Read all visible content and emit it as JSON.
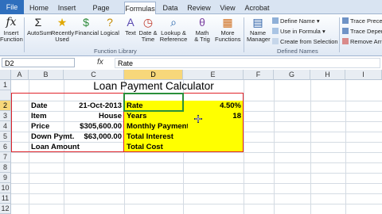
{
  "ribbon_tabs": [
    "File",
    "Home",
    "Insert",
    "Page Layout",
    "Formulas",
    "Data",
    "Review",
    "View",
    "Acrobat"
  ],
  "active_tab": "Formulas",
  "ribbon_buttons": [
    {
      "label": "Insert\nFunction",
      "icon": "fx"
    },
    {
      "label": "AutoSum",
      "icon": "Σ"
    },
    {
      "label": "Recently\nUsed",
      "icon": "★"
    },
    {
      "label": "Financial",
      "icon": "$"
    },
    {
      "label": "Logical",
      "icon": "?"
    },
    {
      "label": "Text",
      "icon": "A"
    },
    {
      "label": "Date &\nTime",
      "icon": "◷"
    },
    {
      "label": "Lookup &\nReference",
      "icon": "⌕"
    },
    {
      "label": "Math\n& Trig",
      "icon": "θ"
    },
    {
      "label": "More\nFunctions",
      "icon": "▦"
    },
    {
      "label": "Name\nManager",
      "icon": "▤"
    }
  ],
  "defined_names": [
    "Define Name",
    "Use in Formula",
    "Create from Selection"
  ],
  "auditing": [
    "Trace Preced",
    "Trace Depen",
    "Remove Arro"
  ],
  "group_labels": {
    "library": "Function Library",
    "names": "Defined Names"
  },
  "name_box": "D2",
  "fx_symbol": "fx",
  "formula": "Rate",
  "columns": [
    "A",
    "B",
    "C",
    "D",
    "E",
    "F",
    "G",
    "H",
    "I"
  ],
  "rows": [
    "1",
    "2",
    "3",
    "4",
    "5",
    "6",
    "7",
    "8",
    "9",
    "10",
    "11",
    "12"
  ],
  "title": "Loan Payment Calculator",
  "left_labels": [
    "Date",
    "Item",
    "Price",
    "Down Pymt.",
    "Loan Amount"
  ],
  "left_values": [
    "21-Oct-2013",
    "House",
    "$305,600.00",
    "$63,000.00",
    ""
  ],
  "right_labels": [
    "Rate",
    "Years",
    "Monthly Payment",
    "Total Interest",
    "Total Cost"
  ],
  "right_values": [
    "4.50%",
    "18",
    "",
    "",
    ""
  ],
  "colors": {
    "highlight": "#ffff00",
    "border": "#e0242a",
    "file_tab": "#2f6fbd"
  }
}
